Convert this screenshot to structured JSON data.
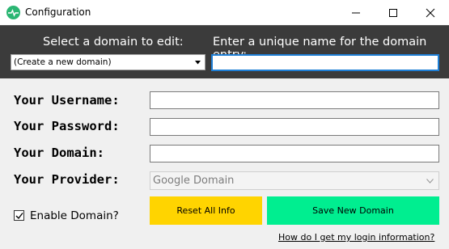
{
  "window": {
    "title": "Configuration",
    "icon": "heartbeat-icon"
  },
  "header": {
    "select_label": "Select a domain to edit:",
    "name_label": "Enter a unique name for the domain entry:",
    "domain_select_value": "(Create a new domain)",
    "name_value": ""
  },
  "form": {
    "username_label": "Your Username:",
    "password_label": "Your Password:",
    "domain_label": "Your Domain:",
    "provider_label": "Your Provider:",
    "username_value": "",
    "password_value": "",
    "domain_value": "",
    "provider_value": "Google Domain"
  },
  "enable": {
    "label": "Enable Domain?",
    "checked": true
  },
  "buttons": {
    "reset_label": "Reset All Info",
    "save_label": "Save New Domain"
  },
  "help_link": "How do I get my login information?",
  "colors": {
    "header_bg": "#3b3b3b",
    "reset_bg": "#ffd400",
    "save_bg": "#00ee90",
    "focus_border": "#1e7fd6",
    "app_icon": "#2bb673"
  }
}
